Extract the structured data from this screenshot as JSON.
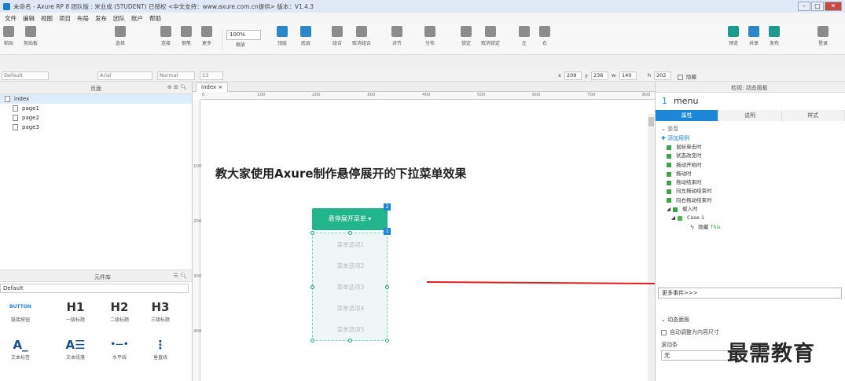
{
  "window": {
    "title": "未命名 - Axure RP 8 团队版 : 米业成 (STUDENT) 已授权    <中文支持：www.axure.com.cn提供> 版本：V1.4.3",
    "controls": [
      "–",
      "□",
      "✕"
    ]
  },
  "menubar": {
    "items": [
      "文件",
      "编辑",
      "视图",
      "项目",
      "布局",
      "发布",
      "团队",
      "账户",
      "帮助"
    ]
  },
  "toolbar": {
    "zoom": "100%",
    "items": [
      {
        "label": "粘贴",
        "icon": "paste-icon"
      },
      {
        "label": "剪贴板",
        "icon": "clipboard-icon"
      },
      {
        "label": "选择",
        "icon": "select-icon"
      },
      {
        "label": "连接",
        "icon": "connect-icon"
      },
      {
        "label": "钢笔",
        "icon": "pen-icon"
      },
      {
        "label": "更多",
        "icon": "more-icon"
      },
      {
        "label": "缩放",
        "icon": "zoom-icon"
      },
      {
        "label": "顶层",
        "icon": "bring-front-icon"
      },
      {
        "label": "底层",
        "icon": "send-back-icon"
      },
      {
        "label": "组合",
        "icon": "group-icon"
      },
      {
        "label": "取消组合",
        "icon": "ungroup-icon"
      },
      {
        "label": "对齐",
        "icon": "align-icon"
      },
      {
        "label": "分布",
        "icon": "distribute-icon"
      },
      {
        "label": "锁定",
        "icon": "lock-icon"
      },
      {
        "label": "取消锁定",
        "icon": "unlock-icon"
      },
      {
        "label": "左",
        "icon": "left-icon"
      },
      {
        "label": "右",
        "icon": "right-icon"
      },
      {
        "label": "预览",
        "icon": "preview-icon"
      },
      {
        "label": "共享",
        "icon": "share-icon"
      },
      {
        "label": "发布",
        "icon": "publish-icon"
      },
      {
        "label": "登录",
        "icon": "user-icon"
      }
    ]
  },
  "stylebar": {
    "style": "Default",
    "font": "Arial",
    "weight": "Normal",
    "size": "13",
    "x_label": "x",
    "x": "209",
    "y_label": "y",
    "y": "236",
    "w_label": "w",
    "w": "140",
    "h_label": "h",
    "h": "202",
    "hidden_label": "隐藏"
  },
  "pages_panel": {
    "title": "页面",
    "pages": [
      "index",
      "page1",
      "page2",
      "page3"
    ]
  },
  "library_panel": {
    "title": "元件库",
    "selected": "Default",
    "widgets": [
      {
        "glyph": "BUTTON",
        "label": "链接按钮"
      },
      {
        "glyph": "H1",
        "label": "一级标题"
      },
      {
        "glyph": "H2",
        "label": "二级标题"
      },
      {
        "glyph": "H3",
        "label": "三级标题"
      },
      {
        "glyph": "A_",
        "label": "文本标签"
      },
      {
        "glyph": "A☰",
        "label": "文本段落"
      },
      {
        "glyph": "•—•",
        "label": "水平线"
      },
      {
        "glyph": "⋮",
        "label": "垂直线"
      }
    ]
  },
  "canvas": {
    "tab": "index",
    "ruler_ticks": [
      "0",
      "100",
      "200",
      "300",
      "400",
      "500",
      "600",
      "700",
      "800"
    ],
    "ruler_v_ticks": [
      "100",
      "200",
      "300",
      "400"
    ],
    "heading": "教大家使用Axure制作悬停展开的下拉菜单效果",
    "button_label": "悬停展开菜单 ▾",
    "badge_button": "2",
    "badge_menu": "1",
    "menu_items": [
      "菜单选项1",
      "菜单选项2",
      "菜单选项3",
      "菜单选项4",
      "菜单选项5"
    ]
  },
  "inspector": {
    "title": "检视: 动态面板",
    "item_number": "1",
    "item_name": "menu",
    "tabs": [
      "属性",
      "说明",
      "样式"
    ],
    "section_interaction": "交互",
    "add_case": "添加用例",
    "events": [
      "鼠标单击时",
      "状态改变时",
      "拖动开始时",
      "拖动时",
      "拖动结束时",
      "向左拖动结束时",
      "向右拖动结束时",
      "载入时"
    ],
    "case_name": "Case 1",
    "action_verb": "隐藏",
    "action_target": "This",
    "more_events": "更多事件>>>",
    "section_dynamic": "动态面板",
    "auto_fit": "自动调整为内容尺寸",
    "scrollbar_label": "滚动条",
    "scrollbar_value": "无"
  },
  "colors": {
    "button_green": "#22b48a",
    "accent_blue": "#1e86d6",
    "arrow_red": "#e02020"
  },
  "watermark": "最需教育"
}
